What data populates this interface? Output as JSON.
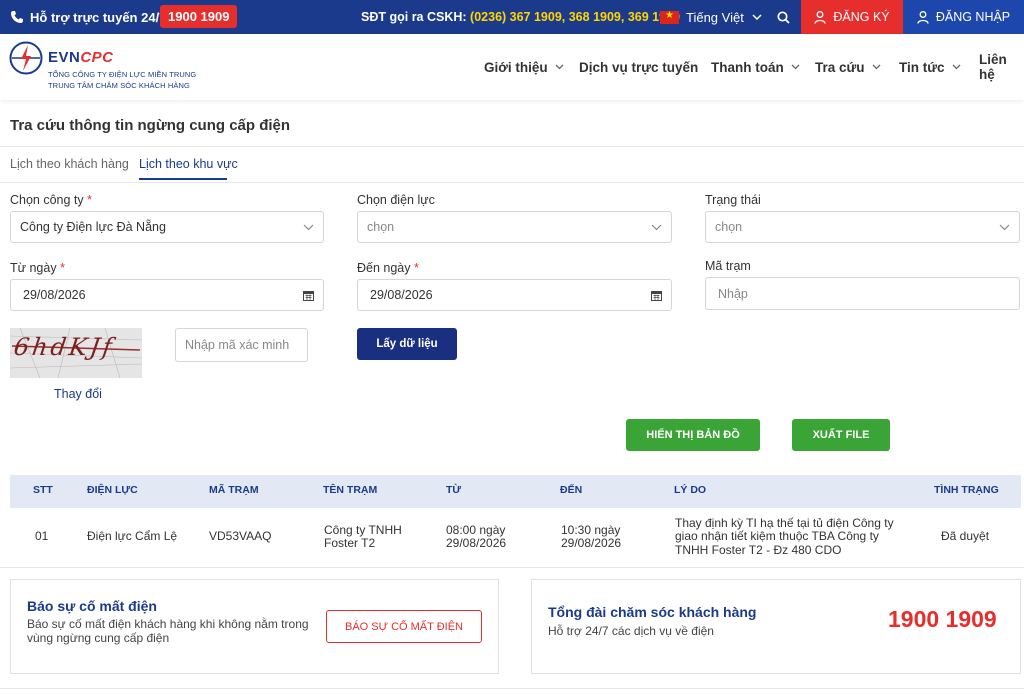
{
  "topbar": {
    "support_label": "Hỗ trợ trực tuyến 24/7:",
    "hotline": "1900 1909",
    "cskh_label": "SĐT gọi ra CSKH:",
    "cskh_numbers": "(0236) 367 1909, 368 1909, 369 1909",
    "language": "Tiếng Việt",
    "register": "ĐĂNG KÝ",
    "login": "ĐĂNG NHẬP"
  },
  "header": {
    "logo_evn": "EVN",
    "logo_cpc": "CPC",
    "logo_line1": "TỔNG CÔNG TY ĐIỆN LỰC MIỀN TRUNG",
    "logo_line2": "TRUNG TÂM CHĂM SÓC KHÁCH HÀNG",
    "nav": [
      "Giới thiệu",
      "Dịch vụ trực tuyến",
      "Thanh toán",
      "Tra cứu",
      "Tin tức",
      "Liên hệ"
    ]
  },
  "page": {
    "title": "Tra cứu thông tin ngừng cung cấp điện",
    "tabs": [
      "Lịch theo khách hàng",
      "Lịch theo khu vực"
    ]
  },
  "form": {
    "company_label": "Chọn công ty",
    "company_value": "Công ty Điện lực Đà Nẵng",
    "district_label": "Chọn điện lực",
    "district_placeholder": "chọn",
    "status_label": "Trạng thái",
    "status_placeholder": "chọn",
    "from_label": "Từ ngày",
    "from_value": "29/08/2026",
    "to_label": "Đến ngày",
    "to_value": "29/08/2026",
    "station_label": "Mã trạm",
    "station_placeholder": "Nhập",
    "required_mark": "*",
    "captcha_text": "6hdKJf",
    "captcha_placeholder": "Nhập mã xác minh",
    "change_captcha": "Thay đổi",
    "fetch_button": "Lấy dữ liệu",
    "map_button": "HIỂN THỊ BẢN ĐỒ",
    "export_button": "XUẤT FILE"
  },
  "table": {
    "headers": [
      "STT",
      "ĐIỆN LỰC",
      "MÃ TRẠM",
      "TÊN TRẠM",
      "TỪ",
      "ĐẾN",
      "LÝ DO",
      "TÌNH TRẠNG"
    ],
    "row": {
      "stt": "01",
      "dien_luc": "Điện lực Cẩm Lệ",
      "ma_tram": "VD53VAAQ",
      "ten_tram_1": "Công ty TNHH",
      "ten_tram_2": "Foster T2",
      "tu_1": "08:00 ngày",
      "tu_2": "29/08/2026",
      "den_1": "10:30 ngày",
      "den_2": "29/08/2026",
      "ly_do_1": "Thay định kỳ TI hạ thế tại tủ điện Công ty",
      "ly_do_2": "giao nhận tiết kiệm thuộc TBA Công ty",
      "ly_do_3": "TNHH Foster T2 - Đz 480 CDO",
      "tinh_trang": "Đã duyệt"
    }
  },
  "report": {
    "title": "Báo sự cố mất điện",
    "desc_1": "Báo sự cố mất điện khách hàng khi không nằm trong",
    "desc_2": "vùng ngừng cung cấp điện",
    "button": "BÁO SỰ CỐ MẤT ĐIỆN"
  },
  "hotline_card": {
    "title": "Tổng đài chăm sóc khách hàng",
    "desc": "Hỗ trợ 24/7 các dịch vụ về điện",
    "phone": "1900 1909"
  }
}
